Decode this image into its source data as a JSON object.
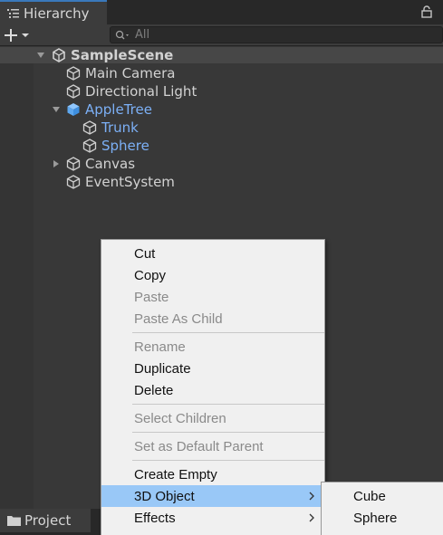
{
  "header": {
    "tab_label": "Hierarchy"
  },
  "toolbar": {
    "search_placeholder": "All"
  },
  "hierarchy": {
    "scene": "SampleScene",
    "items": [
      {
        "label": "Main Camera"
      },
      {
        "label": "Directional Light"
      },
      {
        "label": "AppleTree"
      },
      {
        "label": "Trunk"
      },
      {
        "label": "Sphere"
      },
      {
        "label": "Canvas"
      },
      {
        "label": "EventSystem"
      }
    ]
  },
  "context_menu": {
    "items": [
      {
        "label": "Cut",
        "enabled": true
      },
      {
        "label": "Copy",
        "enabled": true
      },
      {
        "label": "Paste",
        "enabled": false
      },
      {
        "label": "Paste As Child",
        "enabled": false
      },
      {
        "label": "Rename",
        "enabled": false
      },
      {
        "label": "Duplicate",
        "enabled": true
      },
      {
        "label": "Delete",
        "enabled": true
      },
      {
        "label": "Select Children",
        "enabled": false
      },
      {
        "label": "Set as Default Parent",
        "enabled": false
      },
      {
        "label": "Create Empty",
        "enabled": true
      },
      {
        "label": "3D Object",
        "enabled": true,
        "highlighted": true
      },
      {
        "label": "Effects",
        "enabled": true
      }
    ]
  },
  "submenu": {
    "items": [
      {
        "label": "Cube"
      },
      {
        "label": "Sphere"
      }
    ]
  },
  "bottom": {
    "project_tab": "Project"
  },
  "colors": {
    "selected_text": "#7cb0f6",
    "menu_highlight": "#99c8f7",
    "tab_accent": "#3a79bb"
  }
}
